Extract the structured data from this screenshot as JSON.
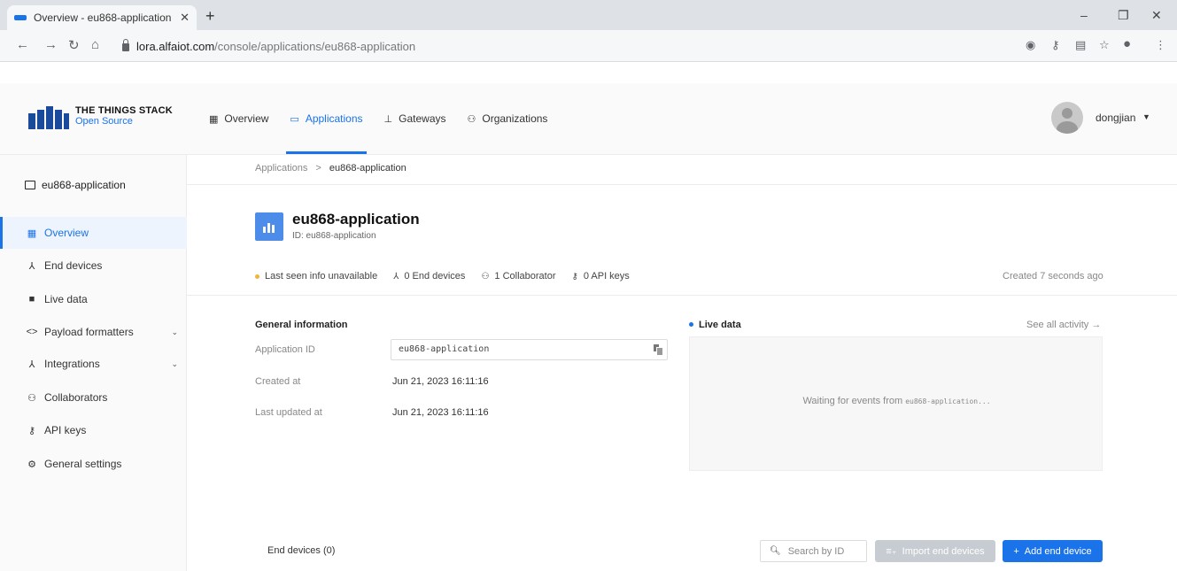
{
  "browser": {
    "tab_title": "Overview - eu868-application",
    "tab_close": "✕",
    "new_tab": "+",
    "url_host": "lora.alfaiot.com",
    "url_path": "/console/applications/eu868-application",
    "controls": {
      "minimize": "–",
      "restore": "❐",
      "close": "✕"
    }
  },
  "brand": {
    "title": "THE THINGS STACK",
    "subtitle": "Open Source",
    "color": "#1a4a9c"
  },
  "topnav": {
    "items": [
      {
        "label": "Overview",
        "icon": "grid-icon",
        "glyph": "▦"
      },
      {
        "label": "Applications",
        "icon": "window-icon",
        "glyph": "▭"
      },
      {
        "label": "Gateways",
        "icon": "gateway-icon",
        "glyph": "⊥"
      },
      {
        "label": "Organizations",
        "icon": "people-icon",
        "glyph": "⚇"
      }
    ],
    "active": "Applications"
  },
  "user": {
    "name": "dongjian"
  },
  "sidebar": {
    "app_name": "eu868-application",
    "items": [
      {
        "label": "Overview",
        "icon": "grid-icon",
        "glyph": "▦"
      },
      {
        "label": "End devices",
        "icon": "device-icon",
        "glyph": "⅄"
      },
      {
        "label": "Live data",
        "icon": "live-data-icon",
        "glyph": "■"
      },
      {
        "label": "Payload formatters",
        "icon": "code-icon",
        "glyph": "<>"
      },
      {
        "label": "Integrations",
        "icon": "integrations-icon",
        "glyph": "⅄"
      },
      {
        "label": "Collaborators",
        "icon": "people-icon",
        "glyph": "⚇"
      },
      {
        "label": "API keys",
        "icon": "key-icon",
        "glyph": "⚷"
      },
      {
        "label": "General settings",
        "icon": "gear-icon",
        "glyph": "⚙"
      }
    ]
  },
  "breadcrumb": {
    "parent": "Applications",
    "separator": ">",
    "current": "eu868-application"
  },
  "app": {
    "name": "eu868-application",
    "id_line": "ID: eu868-application",
    "stats": {
      "last_seen": "Last seen info unavailable",
      "end_devices": "0 End devices",
      "collaborators": "1 Collaborator",
      "api_keys": "0 API keys"
    },
    "created_ago": "Created 7 seconds ago"
  },
  "general_info": {
    "title": "General information",
    "rows": [
      {
        "label": "Application ID",
        "value": "eu868-application"
      },
      {
        "label": "Created at",
        "value": "Jun 21, 2023 16:11:16"
      },
      {
        "label": "Last updated at",
        "value": "Jun 21, 2023 16:11:16"
      }
    ]
  },
  "live_data": {
    "title": "Live data",
    "see_all": "See all activity →",
    "waiting_prefix": "Waiting for events from ",
    "waiting_app": "eu868-application..."
  },
  "end_devices": {
    "title": "End devices (0)",
    "search_placeholder": "Search by ID",
    "import_label": "Import end devices",
    "add_label": "Add end device"
  },
  "colors": {
    "accent": "#1a73e8",
    "warning_dot": "#f1b53c",
    "disabled_button": "#c7ccd3"
  }
}
